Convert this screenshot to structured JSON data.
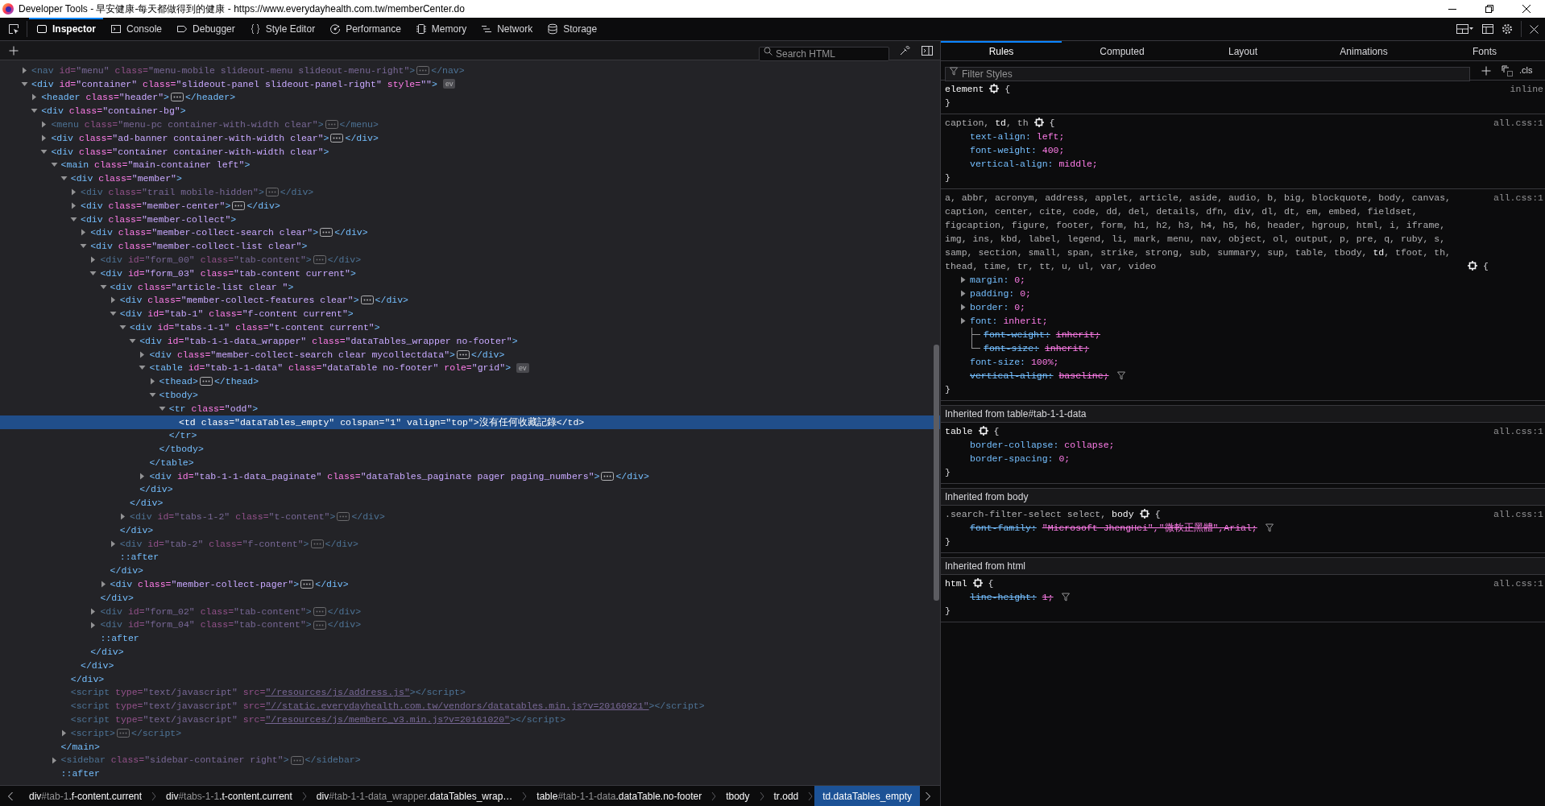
{
  "window": {
    "title": "Developer Tools - 早安健康-每天都做得到的健康 - https://www.everydayhealth.com.tw/memberCenter.do"
  },
  "toolbar_tabs": [
    {
      "label": "Inspector",
      "selected": true
    },
    {
      "label": "Console",
      "selected": false
    },
    {
      "label": "Debugger",
      "selected": false
    },
    {
      "label": "Style Editor",
      "selected": false
    },
    {
      "label": "Performance",
      "selected": false
    },
    {
      "label": "Memory",
      "selected": false
    },
    {
      "label": "Network",
      "selected": false
    },
    {
      "label": "Storage",
      "selected": false
    }
  ],
  "markup_search": {
    "placeholder": "Search HTML"
  },
  "markup_tree": [
    {
      "kind": "branch",
      "expanded": false,
      "dimmed": true,
      "selected": false,
      "open": "<nav",
      "attrs": [
        {
          "name": "id=",
          "value": "\"menu\""
        },
        {
          "name": "class=",
          "value": "\"menu-mobile slideout-menu slideout-menu-right\""
        }
      ],
      "end": ">",
      "inline_close": "</nav>"
    },
    {
      "kind": "branch",
      "expanded": true,
      "dimmed": false,
      "selected": false,
      "open": "<div",
      "attrs": [
        {
          "name": "id=",
          "value": "\"container\""
        },
        {
          "name": "class=",
          "value": "\"slideout-panel slideout-panel-right\""
        },
        {
          "name": "style=",
          "value": "\"\""
        }
      ],
      "end": ">",
      "event_badge": "ev",
      "children": [
        {
          "kind": "branch",
          "expanded": false,
          "dimmed": false,
          "selected": false,
          "open": "<header",
          "attrs": [
            {
              "name": "class=",
              "value": "\"header\""
            }
          ],
          "end": ">",
          "inline_close": "</header>"
        },
        {
          "kind": "branch",
          "expanded": true,
          "dimmed": false,
          "selected": false,
          "open": "<div",
          "attrs": [
            {
              "name": "class=",
              "value": "\"container-bg\""
            }
          ],
          "end": ">",
          "children": [
            {
              "kind": "branch",
              "expanded": false,
              "dimmed": true,
              "selected": false,
              "open": "<menu",
              "attrs": [
                {
                  "name": "class=",
                  "value": "\"menu-pc container-with-width clear\""
                }
              ],
              "end": ">",
              "inline_close": "</menu>"
            },
            {
              "kind": "branch",
              "expanded": false,
              "dimmed": false,
              "selected": false,
              "open": "<div",
              "attrs": [
                {
                  "name": "class=",
                  "value": "\"ad-banner container-with-width clear\""
                }
              ],
              "end": ">",
              "inline_close": "</div>"
            },
            {
              "kind": "branch",
              "expanded": true,
              "dimmed": false,
              "selected": false,
              "open": "<div",
              "attrs": [
                {
                  "name": "class=",
                  "value": "\"container container-with-width clear\""
                }
              ],
              "end": ">",
              "children": [
                {
                  "kind": "branch",
                  "expanded": true,
                  "dimmed": false,
                  "selected": false,
                  "open": "<main",
                  "attrs": [
                    {
                      "name": "class=",
                      "value": "\"main-container left\""
                    }
                  ],
                  "end": ">",
                  "close": "</main>",
                  "children": [
                    {
                      "kind": "branch",
                      "expanded": true,
                      "dimmed": false,
                      "selected": false,
                      "open": "<div",
                      "attrs": [
                        {
                          "name": "class=",
                          "value": "\"member\""
                        }
                      ],
                      "end": ">",
                      "close": "</div>",
                      "children": [
                        {
                          "kind": "branch",
                          "expanded": false,
                          "dimmed": true,
                          "selected": false,
                          "open": "<div",
                          "attrs": [
                            {
                              "name": "class=",
                              "value": "\"trail mobile-hidden\""
                            }
                          ],
                          "end": ">",
                          "inline_close": "</div>"
                        },
                        {
                          "kind": "branch",
                          "expanded": false,
                          "dimmed": false,
                          "selected": false,
                          "open": "<div",
                          "attrs": [
                            {
                              "name": "class=",
                              "value": "\"member-center\""
                            }
                          ],
                          "end": ">",
                          "inline_close": "</div>"
                        },
                        {
                          "kind": "branch",
                          "expanded": true,
                          "dimmed": false,
                          "selected": false,
                          "open": "<div",
                          "attrs": [
                            {
                              "name": "class=",
                              "value": "\"member-collect\""
                            }
                          ],
                          "end": ">",
                          "close": "</div>",
                          "children": [
                            {
                              "kind": "branch",
                              "expanded": false,
                              "dimmed": false,
                              "selected": false,
                              "open": "<div",
                              "attrs": [
                                {
                                  "name": "class=",
                                  "value": "\"member-collect-search clear\""
                                }
                              ],
                              "end": ">",
                              "inline_close": "</div>"
                            },
                            {
                              "kind": "branch",
                              "expanded": true,
                              "dimmed": false,
                              "selected": false,
                              "open": "<div",
                              "attrs": [
                                {
                                  "name": "class=",
                                  "value": "\"member-collect-list clear\""
                                }
                              ],
                              "end": ">",
                              "close": "</div>",
                              "children": [
                                {
                                  "kind": "branch",
                                  "expanded": false,
                                  "dimmed": true,
                                  "selected": false,
                                  "open": "<div",
                                  "attrs": [
                                    {
                                      "name": "id=",
                                      "value": "\"form_00\""
                                    },
                                    {
                                      "name": "class=",
                                      "value": "\"tab-content\""
                                    }
                                  ],
                                  "end": ">",
                                  "inline_close": "</div>"
                                },
                                {
                                  "kind": "branch",
                                  "expanded": true,
                                  "dimmed": false,
                                  "selected": false,
                                  "open": "<div",
                                  "attrs": [
                                    {
                                      "name": "id=",
                                      "value": "\"form_03\""
                                    },
                                    {
                                      "name": "class=",
                                      "value": "\"tab-content current\""
                                    }
                                  ],
                                  "end": ">",
                                  "close": "</div>",
                                  "children": [
                                    {
                                      "kind": "branch",
                                      "expanded": true,
                                      "dimmed": false,
                                      "selected": false,
                                      "open": "<div",
                                      "attrs": [
                                        {
                                          "name": "class=",
                                          "value": "\"article-list clear \""
                                        }
                                      ],
                                      "end": ">",
                                      "close": "</div>",
                                      "children": [
                                        {
                                          "kind": "branch",
                                          "expanded": false,
                                          "dimmed": false,
                                          "selected": false,
                                          "open": "<div",
                                          "attrs": [
                                            {
                                              "name": "class=",
                                              "value": "\"member-collect-features clear\""
                                            }
                                          ],
                                          "end": ">",
                                          "inline_close": "</div>"
                                        },
                                        {
                                          "kind": "branch",
                                          "expanded": true,
                                          "dimmed": false,
                                          "selected": false,
                                          "open": "<div",
                                          "attrs": [
                                            {
                                              "name": "id=",
                                              "value": "\"tab-1\""
                                            },
                                            {
                                              "name": "class=",
                                              "value": "\"f-content current\""
                                            }
                                          ],
                                          "end": ">",
                                          "close": "</div>",
                                          "children": [
                                            {
                                              "kind": "branch",
                                              "expanded": true,
                                              "dimmed": false,
                                              "selected": false,
                                              "open": "<div",
                                              "attrs": [
                                                {
                                                  "name": "id=",
                                                  "value": "\"tabs-1-1\""
                                                },
                                                {
                                                  "name": "class=",
                                                  "value": "\"t-content current\""
                                                }
                                              ],
                                              "end": ">",
                                              "close": "</div>",
                                              "children": [
                                                {
                                                  "kind": "branch",
                                                  "expanded": true,
                                                  "dimmed": false,
                                                  "selected": false,
                                                  "open": "<div",
                                                  "attrs": [
                                                    {
                                                      "name": "id=",
                                                      "value": "\"tab-1-1-data_wrapper\""
                                                    },
                                                    {
                                                      "name": "class=",
                                                      "value": "\"dataTables_wrapper no-footer\""
                                                    }
                                                  ],
                                                  "end": ">",
                                                  "close": "</div>",
                                                  "children": [
                                                    {
                                                      "kind": "branch",
                                                      "expanded": false,
                                                      "dimmed": false,
                                                      "selected": false,
                                                      "open": "<div",
                                                      "attrs": [
                                                        {
                                                          "name": "class=",
                                                          "value": "\"member-collect-search clear mycollectdata\""
                                                        }
                                                      ],
                                                      "end": ">",
                                                      "inline_close": "</div>"
                                                    },
                                                    {
                                                      "kind": "branch",
                                                      "expanded": true,
                                                      "dimmed": false,
                                                      "selected": false,
                                                      "open": "<table",
                                                      "attrs": [
                                                        {
                                                          "name": "id=",
                                                          "value": "\"tab-1-1-data\""
                                                        },
                                                        {
                                                          "name": "class=",
                                                          "value": "\"dataTable no-footer\""
                                                        },
                                                        {
                                                          "name": "role=",
                                                          "value": "\"grid\""
                                                        }
                                                      ],
                                                      "end": ">",
                                                      "event_badge": "ev",
                                                      "close": "</table>",
                                                      "children": [
                                                        {
                                                          "kind": "branch",
                                                          "expanded": false,
                                                          "dimmed": false,
                                                          "selected": false,
                                                          "open": "<thead",
                                                          "end": ">",
                                                          "inline_close": "</thead>"
                                                        },
                                                        {
                                                          "kind": "branch",
                                                          "expanded": true,
                                                          "dimmed": false,
                                                          "selected": false,
                                                          "open": "<tbody",
                                                          "end": ">",
                                                          "close": "</tbody>",
                                                          "children": [
                                                            {
                                                              "kind": "branch",
                                                              "expanded": true,
                                                              "dimmed": false,
                                                              "selected": false,
                                                              "open": "<tr",
                                                              "attrs": [
                                                                {
                                                                  "name": "class=",
                                                                  "value": "\"odd\""
                                                                }
                                                              ],
                                                              "end": ">",
                                                              "close": "</tr>",
                                                              "children": [
                                                                {
                                                                  "kind": "leaf",
                                                                  "dimmed": false,
                                                                  "selected": true,
                                                                  "open": "<td",
                                                                  "attrs": [
                                                                    {
                                                                      "name": "class=",
                                                                      "value": "\"dataTables_empty\""
                                                                    },
                                                                    {
                                                                      "name": "colspan=",
                                                                      "value": "\"1\""
                                                                    },
                                                                    {
                                                                      "name": "valign=",
                                                                      "value": "\"top\""
                                                                    }
                                                                  ],
                                                                  "end": ">",
                                                                  "content": "沒有任何收藏記錄",
                                                                  "inline_close": "</td>"
                                                                }
                                                              ]
                                                            }
                                                          ]
                                                        }
                                                      ]
                                                    },
                                                    {
                                                      "kind": "branch",
                                                      "expanded": false,
                                                      "dimmed": false,
                                                      "selected": false,
                                                      "open": "<div",
                                                      "attrs": [
                                                        {
                                                          "name": "id=",
                                                          "value": "\"tab-1-1-data_paginate\""
                                                        },
                                                        {
                                                          "name": "class=",
                                                          "value": "\"dataTables_paginate pager paging_numbers\""
                                                        }
                                                      ],
                                                      "end": ">",
                                                      "inline_close": "</div>"
                                                    }
                                                  ]
                                                }
                                              ]
                                            },
                                            {
                                              "kind": "branch",
                                              "expanded": false,
                                              "dimmed": true,
                                              "selected": false,
                                              "open": "<div",
                                              "attrs": [
                                                {
                                                  "name": "id=",
                                                  "value": "\"tabs-1-2\""
                                                },
                                                {
                                                  "name": "class=",
                                                  "value": "\"t-content\""
                                                }
                                              ],
                                              "end": ">",
                                              "inline_close": "</div>"
                                            }
                                          ]
                                        },
                                        {
                                          "kind": "branch",
                                          "expanded": false,
                                          "dimmed": true,
                                          "selected": false,
                                          "open": "<div",
                                          "attrs": [
                                            {
                                              "name": "id=",
                                              "value": "\"tab-2\""
                                            },
                                            {
                                              "name": "class=",
                                              "value": "\"f-content\""
                                            }
                                          ],
                                          "end": ">",
                                          "inline_close": "</div>"
                                        },
                                        {
                                          "kind": "pseudo",
                                          "dimmed": false,
                                          "selected": false,
                                          "text": "::after"
                                        }
                                      ]
                                    },
                                    {
                                      "kind": "branch",
                                      "expanded": false,
                                      "dimmed": false,
                                      "selected": false,
                                      "open": "<div",
                                      "attrs": [
                                        {
                                          "name": "class=",
                                          "value": "\"member-collect-pager\""
                                        }
                                      ],
                                      "end": ">",
                                      "inline_close": "</div>"
                                    }
                                  ]
                                },
                                {
                                  "kind": "branch",
                                  "expanded": false,
                                  "dimmed": true,
                                  "selected": false,
                                  "open": "<div",
                                  "attrs": [
                                    {
                                      "name": "id=",
                                      "value": "\"form_02\""
                                    },
                                    {
                                      "name": "class=",
                                      "value": "\"tab-content\""
                                    }
                                  ],
                                  "end": ">",
                                  "inline_close": "</div>"
                                },
                                {
                                  "kind": "branch",
                                  "expanded": false,
                                  "dimmed": true,
                                  "selected": false,
                                  "open": "<div",
                                  "attrs": [
                                    {
                                      "name": "id=",
                                      "value": "\"form_04\""
                                    },
                                    {
                                      "name": "class=",
                                      "value": "\"tab-content\""
                                    }
                                  ],
                                  "end": ">",
                                  "inline_close": "</div>"
                                },
                                {
                                  "kind": "pseudo",
                                  "dimmed": false,
                                  "selected": false,
                                  "text": "::after"
                                }
                              ]
                            }
                          ]
                        }
                      ]
                    },
                    {
                      "kind": "leaf",
                      "dimmed": true,
                      "selected": false,
                      "open": "<script",
                      "attrs": [
                        {
                          "name": "type=",
                          "value": "\"text/javascript\""
                        },
                        {
                          "name": "src=",
                          "value": "\"/resources/js/address.js\"",
                          "link": true
                        }
                      ],
                      "end": ">",
                      "inline_close": "</script>"
                    },
                    {
                      "kind": "leaf",
                      "dimmed": true,
                      "selected": false,
                      "open": "<script",
                      "attrs": [
                        {
                          "name": "type=",
                          "value": "\"text/javascript\""
                        },
                        {
                          "name": "src=",
                          "value": "\"//static.everydayhealth.com.tw/vendors/datatables.min.js?v=20160921\"",
                          "link": true
                        }
                      ],
                      "end": ">",
                      "inline_close": "</script>"
                    },
                    {
                      "kind": "leaf",
                      "dimmed": true,
                      "selected": false,
                      "open": "<script",
                      "attrs": [
                        {
                          "name": "type=",
                          "value": "\"text/javascript\""
                        },
                        {
                          "name": "src=",
                          "value": "\"/resources/js/memberc_v3.min.js?v=20161020\"",
                          "link": true
                        }
                      ],
                      "end": ">",
                      "inline_close": "</script>"
                    },
                    {
                      "kind": "branch",
                      "expanded": false,
                      "dimmed": true,
                      "selected": false,
                      "open": "<script",
                      "end": ">",
                      "inline_close": "</script>"
                    }
                  ]
                },
                {
                  "kind": "branch",
                  "expanded": false,
                  "dimmed": true,
                  "selected": false,
                  "open": "<sidebar",
                  "attrs": [
                    {
                      "name": "class=",
                      "value": "\"sidebar-container right\""
                    }
                  ],
                  "end": ">",
                  "inline_close": "</sidebar>"
                },
                {
                  "kind": "pseudo",
                  "dimmed": false,
                  "selected": false,
                  "text": "::after"
                }
              ]
            }
          ]
        }
      ]
    }
  ],
  "breadcrumbs": [
    {
      "tag": "div",
      "id": "#tab-1",
      "classes": ".f-content.current",
      "selected": false
    },
    {
      "tag": "div",
      "id": "#tabs-1-1",
      "classes": ".t-content.current",
      "selected": false
    },
    {
      "tag": "div",
      "id": "#tab-1-1-data_wrapper",
      "classes": ".dataTables_wrap…",
      "selected": false
    },
    {
      "tag": "table",
      "id": "#tab-1-1-data",
      "classes": ".dataTable.no-footer",
      "selected": false
    },
    {
      "tag": "tbody",
      "selected": false
    },
    {
      "tag": "tr",
      "classes": ".odd",
      "selected": false
    },
    {
      "tag": "td",
      "classes": ".dataTables_empty",
      "selected": true
    }
  ],
  "sidebar_tabs": [
    {
      "label": "Rules",
      "selected": true
    },
    {
      "label": "Computed",
      "selected": false
    },
    {
      "label": "Layout",
      "selected": false
    },
    {
      "label": "Animations",
      "selected": false
    },
    {
      "label": "Fonts",
      "selected": false
    }
  ],
  "style_filter": {
    "placeholder": "Filter Styles"
  },
  "class_toggle": ".cls",
  "rule_sections": [
    {
      "rules": [
        {
          "selector": [
            {
              "text": "element",
              "matched": true
            }
          ],
          "open_brace": "{",
          "source": "inline",
          "close_brace": "}"
        },
        {
          "selector": [
            {
              "text": "caption, ",
              "matched": false
            },
            {
              "text": "td",
              "matched": true
            },
            {
              "text": ", th",
              "matched": false
            }
          ],
          "open_brace": "{",
          "source": "all.css:1",
          "declarations": [
            {
              "name": "text-align:",
              "value": "left;",
              "overridden": false,
              "expandable": false,
              "filter_icon": false
            },
            {
              "name": "font-weight:",
              "value": "400;",
              "overridden": false,
              "expandable": false,
              "filter_icon": false
            },
            {
              "name": "vertical-align:",
              "value": "middle;",
              "overridden": false,
              "expandable": false,
              "filter_icon": false
            }
          ],
          "close_brace": "}"
        },
        {
          "selector": [
            {
              "text": "a, abbr, acronym, address, applet, article, aside, audio, b, big, blockquote, body, canvas, caption, center, cite, code, dd, del, details, dfn, div, dl, dt, em, embed, fieldset, figcaption, figure, footer, form, h1, h2, h3, h4, h5, h6, header, hgroup, html, i, iframe, img, ins, kbd, label, legend, li, mark, menu, nav, object, ol, output, p, pre, q, ruby, s, samp, section, small, span, strike, strong, sub, summary, sup, table, tbody, ",
              "matched": false
            },
            {
              "text": "td",
              "matched": true
            },
            {
              "text": ", tfoot, th, thead, time, tr, tt, u, ul, var, video",
              "matched": false
            }
          ],
          "open_brace": "{",
          "source": "all.css:1",
          "declarations": [
            {
              "name": "margin:",
              "value": "0;",
              "overridden": false,
              "expandable": true,
              "filter_icon": false
            },
            {
              "name": "padding:",
              "value": "0;",
              "overridden": false,
              "expandable": true,
              "filter_icon": false
            },
            {
              "name": "border:",
              "value": "0;",
              "overridden": false,
              "expandable": true,
              "filter_icon": false
            },
            {
              "name": "font:",
              "value": "inherit;",
              "overridden": false,
              "expandable": true,
              "filter_icon": false,
              "children": [
                {
                  "name": "font-weight:",
                  "value": "inherit;",
                  "overridden": true
                },
                {
                  "name": "font-size:",
                  "value": "inherit;",
                  "overridden": true
                }
              ]
            },
            {
              "name": "font-size:",
              "value": "100%;",
              "overridden": false,
              "expandable": false,
              "filter_icon": false
            },
            {
              "name": "vertical-align:",
              "value": "baseline;",
              "overridden": true,
              "expandable": false,
              "filter_icon": true
            }
          ],
          "close_brace": "}"
        }
      ]
    },
    {
      "heading": "Inherited from table#tab-1-1-data",
      "rules": [
        {
          "selector": [
            {
              "text": "table",
              "matched": true
            }
          ],
          "open_brace": "{",
          "source": "all.css:1",
          "declarations": [
            {
              "name": "border-collapse:",
              "value": "collapse;",
              "overridden": false,
              "expandable": false,
              "filter_icon": false
            },
            {
              "name": "border-spacing:",
              "value": "0;",
              "overridden": false,
              "expandable": false,
              "filter_icon": false
            }
          ],
          "close_brace": "}"
        }
      ]
    },
    {
      "heading": "Inherited from body",
      "rules": [
        {
          "selector": [
            {
              "text": ".search-filter-select select, ",
              "matched": false
            },
            {
              "text": "body",
              "matched": true
            }
          ],
          "open_brace": "{",
          "source": "all.css:1",
          "declarations": [
            {
              "name": "font-family:",
              "value": "\"Microsoft JhengHei\",\"微軟正黑體\",Arial;",
              "overridden": true,
              "expandable": false,
              "filter_icon": true
            }
          ],
          "close_brace": "}"
        }
      ]
    },
    {
      "heading": "Inherited from html",
      "rules": [
        {
          "selector": [
            {
              "text": "html",
              "matched": true
            }
          ],
          "open_brace": "{",
          "source": "all.css:1",
          "declarations": [
            {
              "name": "line-height:",
              "value": "1;",
              "overridden": true,
              "expandable": false,
              "filter_icon": true
            }
          ],
          "close_brace": "}"
        }
      ]
    }
  ]
}
